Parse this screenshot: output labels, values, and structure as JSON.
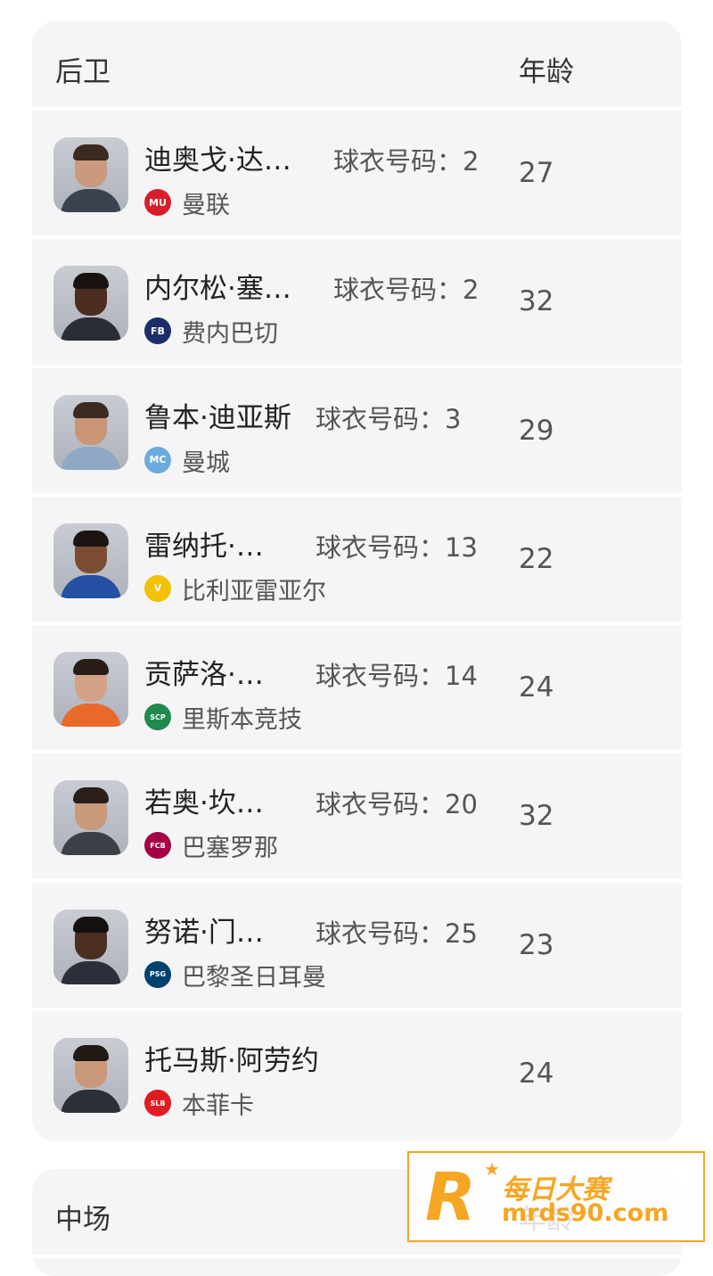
{
  "defenders": {
    "header": {
      "position": "后卫",
      "age": "年龄"
    },
    "players": [
      {
        "name": "迪奥戈·达…",
        "jersey": "球衣号码：2",
        "club": "曼联",
        "age": "27",
        "club_color": "#d81e2b",
        "club_abbr": "MU",
        "skin": "#c99a7d",
        "hair": "#3a2a22",
        "shirt": "#3b4350"
      },
      {
        "name": "内尔松·塞…",
        "jersey": "球衣号码：2",
        "club": "费内巴切",
        "age": "32",
        "club_color": "#1b2e6b",
        "club_abbr": "FB",
        "skin": "#4a2c20",
        "hair": "#1a1210",
        "shirt": "#2a2d35"
      },
      {
        "name": "鲁本·迪亚斯",
        "jersey": "球衣号码：3",
        "club": "曼城",
        "age": "29",
        "club_color": "#6cabdd",
        "club_abbr": "MC",
        "skin": "#c89677",
        "hair": "#3b2b22",
        "shirt": "#8fa9c4"
      },
      {
        "name": "雷纳托·…",
        "jersey": "球衣号码：13",
        "club": "比利亚雷亚尔",
        "age": "22",
        "club_color": "#f2c100",
        "club_abbr": "V",
        "skin": "#7a4d33",
        "hair": "#1c1410",
        "shirt": "#2450a3"
      },
      {
        "name": "贡萨洛·…",
        "jersey": "球衣号码：14",
        "club": "里斯本竞技",
        "age": "24",
        "club_color": "#1f8a4c",
        "club_abbr": "SCP",
        "skin": "#d3a286",
        "hair": "#2a1d18",
        "shirt": "#e86a2b"
      },
      {
        "name": "若奥·坎…",
        "jersey": "球衣号码：20",
        "club": "巴塞罗那",
        "age": "32",
        "club_color": "#a50044",
        "club_abbr": "FCB",
        "skin": "#c69a7a",
        "hair": "#2a1e18",
        "shirt": "#3b3f48"
      },
      {
        "name": "努诺·门…",
        "jersey": "球衣号码：25",
        "club": "巴黎圣日耳曼",
        "age": "23",
        "club_color": "#004170",
        "club_abbr": "PSG",
        "skin": "#4b2d22",
        "hair": "#151010",
        "shirt": "#2b2f3a"
      },
      {
        "name": "托马斯·阿劳约",
        "jersey": "",
        "club": "本菲卡",
        "age": "24",
        "club_color": "#e11b22",
        "club_abbr": "SLB",
        "skin": "#c9987a",
        "hair": "#231915",
        "shirt": "#2d2f36"
      }
    ]
  },
  "midfielders": {
    "header": {
      "position": "中场",
      "age": "年龄"
    }
  },
  "watermark": {
    "logo_letter": "R",
    "title": "每日大赛",
    "url": "mrds90.com"
  }
}
